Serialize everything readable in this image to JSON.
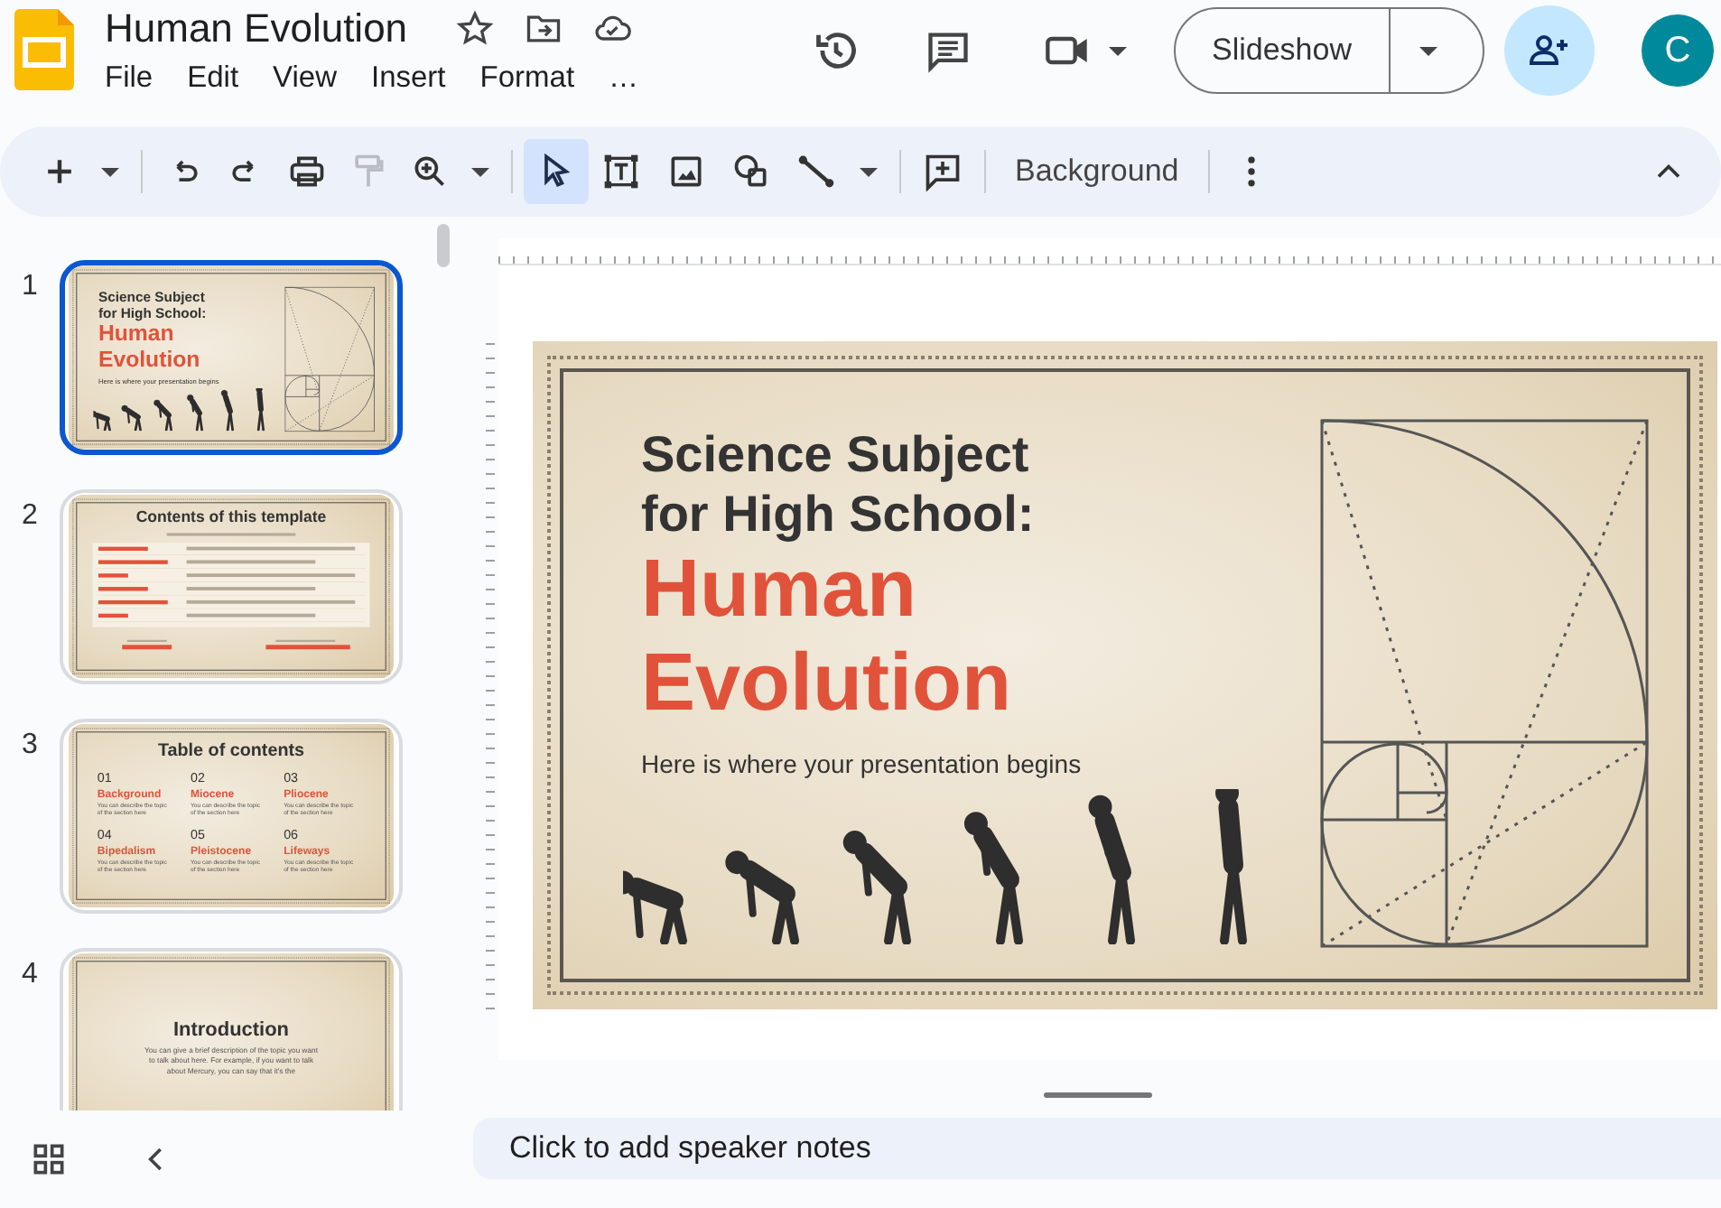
{
  "app": {
    "title": "Human Evolution",
    "menu": [
      {
        "label": "File"
      },
      {
        "label": "Edit"
      },
      {
        "label": "View"
      },
      {
        "label": "Insert"
      },
      {
        "label": "Format"
      },
      {
        "label": "…"
      }
    ]
  },
  "header": {
    "slideshow_button": "Slideshow",
    "avatar_initial": "C"
  },
  "toolbar": {
    "paint_format": {
      "disabled": true
    },
    "tools": [
      {
        "kind": "select",
        "selected": true
      },
      {
        "kind": "text_box",
        "selected": false
      },
      {
        "kind": "image",
        "selected": false
      },
      {
        "kind": "shape",
        "selected": false
      },
      {
        "kind": "line",
        "selected": false
      }
    ],
    "background_button": "Background"
  },
  "slides": [
    {
      "number": "1",
      "selected": true,
      "kind": "title",
      "title_lines": [
        "Science Subject",
        "for High School:"
      ],
      "heading_lines": [
        "Human",
        "Evolution"
      ],
      "subtitle": "Here is where your presentation begins"
    },
    {
      "number": "2",
      "selected": false,
      "kind": "contents",
      "title": "Contents of this template"
    },
    {
      "number": "3",
      "selected": false,
      "kind": "toc",
      "title": "Table of contents",
      "sections": [
        {
          "number": "01",
          "title": "Background",
          "text": "You can describe the topic of the section here"
        },
        {
          "number": "02",
          "title": "Miocene",
          "text": "You can describe the topic of the section here"
        },
        {
          "number": "03",
          "title": "Pliocene",
          "text": "You can describe the topic of the section here"
        },
        {
          "number": "04",
          "title": "Bipedalism",
          "text": "You can describe the topic of the section here"
        },
        {
          "number": "05",
          "title": "Pleistocene",
          "text": "You can describe the topic of the section here"
        },
        {
          "number": "06",
          "title": "Lifeways",
          "text": "You can describe the topic of the section here"
        }
      ]
    },
    {
      "number": "4",
      "selected": false,
      "kind": "intro",
      "title": "Introduction",
      "text": "You can give a brief description of the topic you want to talk about here. For example, if you want to talk about Mercury, you can say that it's the"
    }
  ],
  "editor": {
    "slide": {
      "title_lines": [
        "Science Subject",
        "for High School:"
      ],
      "heading_lines": [
        "Human",
        "Evolution"
      ],
      "subtitle": "Here is where your presentation begins"
    },
    "speaker_notes": {
      "placeholder": "Click to add speaker notes"
    }
  }
}
